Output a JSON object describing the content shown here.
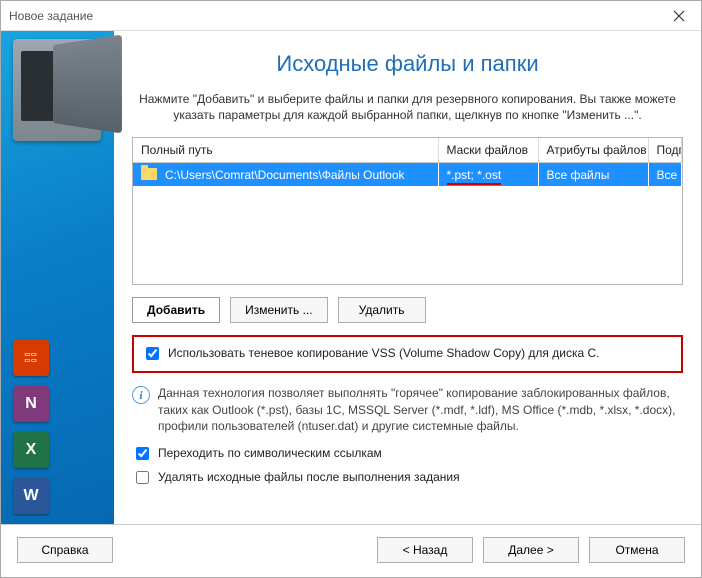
{
  "window": {
    "title": "Новое задание"
  },
  "header": {
    "title": "Исходные файлы и папки",
    "intro": "Нажмите \"Добавить\" и выберите файлы и папки для резервного копирования. Вы также можете указать параметры для каждой выбранной папки, щелкнув по кнопке \"Изменить ...\"."
  },
  "grid": {
    "columns": {
      "path": "Полный путь",
      "masks": "Маски файлов",
      "attrs": "Атрибуты файлов",
      "sub": "Подп"
    },
    "rows": [
      {
        "path": "C:\\Users\\Comrat\\Documents\\Файлы Outlook",
        "masks": "*.pst; *.ost",
        "attrs": "Все файлы",
        "sub": "Все"
      }
    ]
  },
  "buttons": {
    "add": "Добавить",
    "edit": "Изменить ...",
    "delete": "Удалить"
  },
  "options": {
    "vss": "Использовать теневое копирование VSS (Volume Shadow Copy) для диска C.",
    "vss_info": "Данная технология позволяет выполнять \"горячее\" копирование заблокированных файлов, таких как Outlook (*.pst), базы 1C, MSSQL Server (*.mdf, *.ldf), MS Office (*.mdb, *.xlsx, *.docx), профили пользователей (ntuser.dat) и другие системные файлы.",
    "symlinks": "Переходить по символическим ссылкам",
    "delete_after": "Удалять исходные файлы после выполнения задания"
  },
  "footer": {
    "help": "Справка",
    "back": "< Назад",
    "next": "Далее >",
    "cancel": "Отмена"
  },
  "icons": {
    "onenote": "N",
    "excel": "X",
    "word": "W",
    "info": "i"
  }
}
